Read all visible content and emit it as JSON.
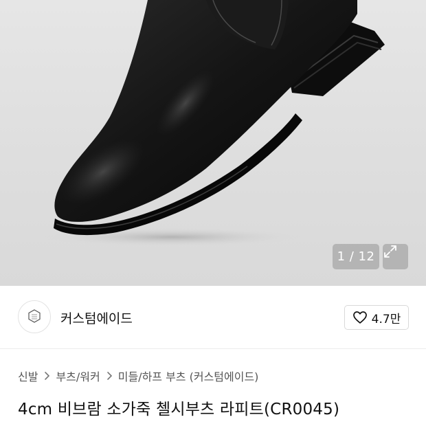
{
  "gallery": {
    "counter": "1 / 12",
    "image_alt": "black chelsea boot",
    "expand_icon": "expand-icon"
  },
  "brand": {
    "name": "커스텀에이드",
    "logo_icon": "brand-logo-icon",
    "like_icon": "heart-icon",
    "like_count": "4.7만"
  },
  "breadcrumb": {
    "items": [
      "신발",
      "부츠/워커",
      "미들/하프 부츠 (커스텀에이드)"
    ],
    "separator_icon": "chevron-right-icon"
  },
  "product": {
    "title": "4cm 비브람 소가죽 첼시부츠 라피트(CR0045)"
  },
  "colors": {
    "background": "#ffffff",
    "image_background": "#e0e0e0",
    "text_primary": "#111111",
    "text_secondary": "#555555"
  }
}
